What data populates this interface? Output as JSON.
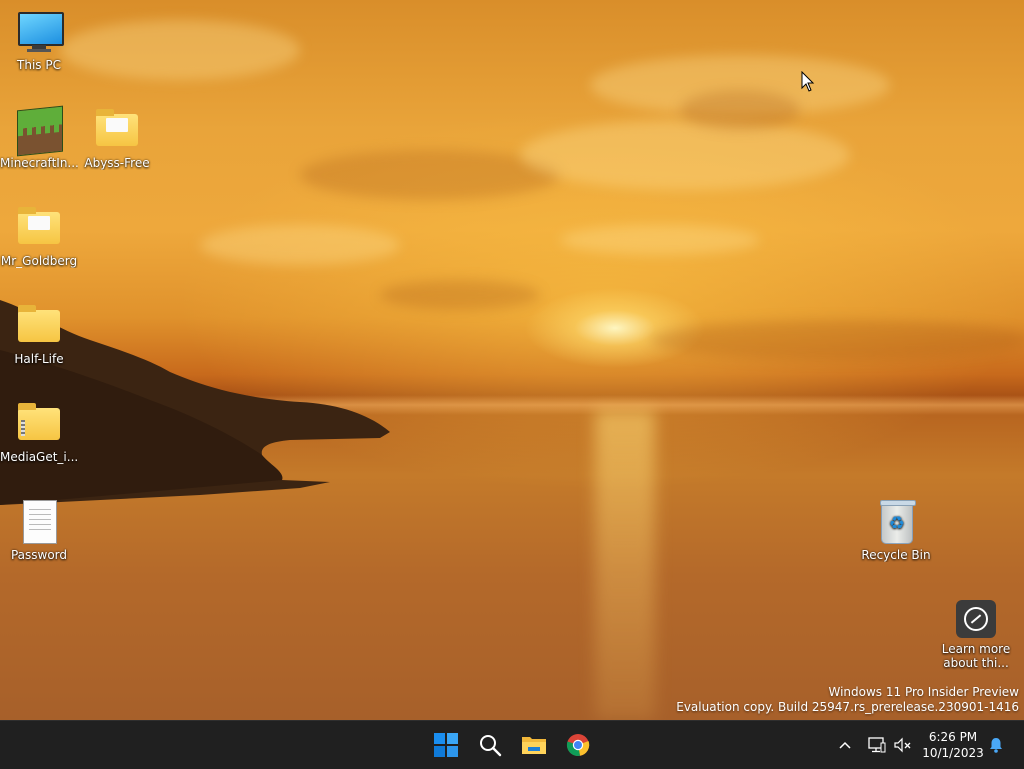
{
  "desktop": {
    "icons": [
      {
        "label": "This PC"
      },
      {
        "label": "MinecraftIn..."
      },
      {
        "label": "Abyss-Free"
      },
      {
        "label": "Mr_Goldberg"
      },
      {
        "label": "Half-Life"
      },
      {
        "label": "MediaGet_i..."
      },
      {
        "label": "Password"
      },
      {
        "label": "Recycle Bin"
      },
      {
        "label_line1": "Learn more",
        "label_line2": "about thi..."
      }
    ],
    "watermark": {
      "line1": "Windows 11 Pro Insider Preview",
      "line2": "Evaluation copy. Build 25947.rs_prerelease.230901-1416"
    }
  },
  "taskbar": {
    "pinned": [
      {
        "icon": "windows-start-icon"
      },
      {
        "icon": "search-icon"
      },
      {
        "icon": "file-explorer-icon"
      },
      {
        "icon": "chrome-icon"
      }
    ],
    "tray": {
      "overflow_icon": "chevron-up-icon",
      "network_icon": "network-icon",
      "volume_icon": "volume-muted-icon",
      "notification_icon": "bell-icon"
    },
    "clock": {
      "time": "6:26 PM",
      "date": "10/1/2023"
    }
  },
  "colors": {
    "taskbar_bg": "#202020",
    "windows_blue": "#1a8ef0",
    "folder_yellow": "#f6c543"
  }
}
